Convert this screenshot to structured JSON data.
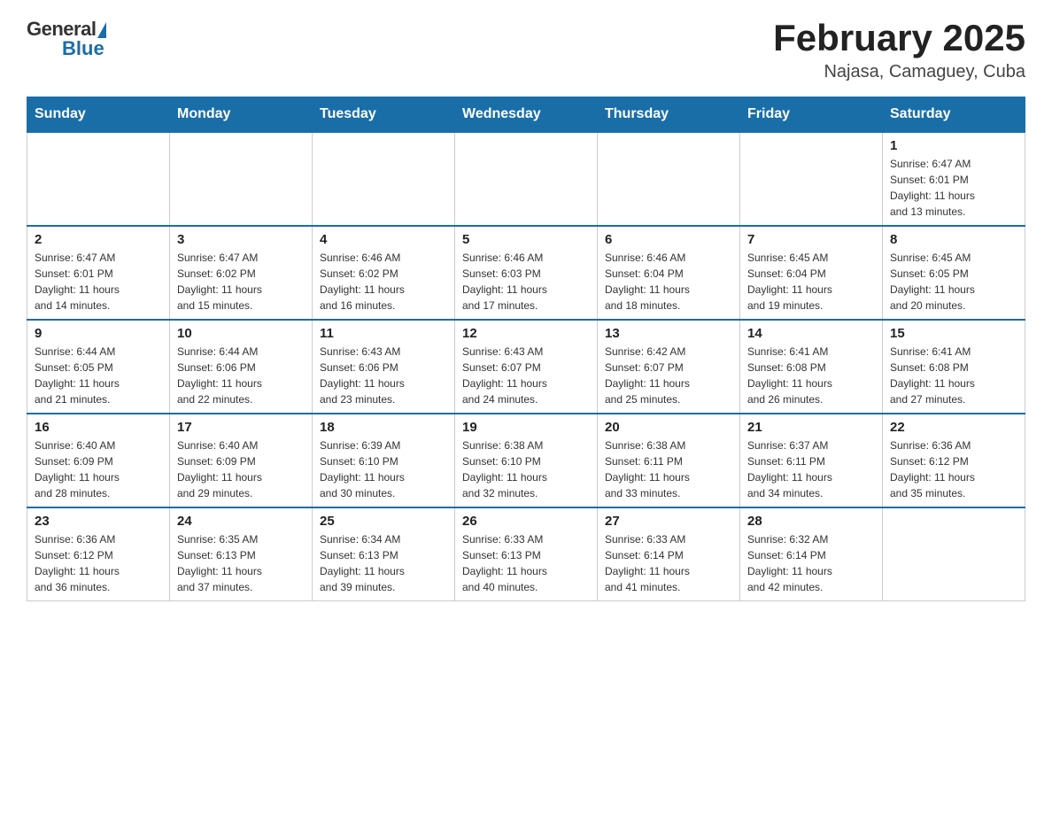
{
  "header": {
    "logo": {
      "general": "General",
      "blue": "Blue"
    },
    "title": "February 2025",
    "subtitle": "Najasa, Camaguey, Cuba"
  },
  "weekdays": [
    "Sunday",
    "Monday",
    "Tuesday",
    "Wednesday",
    "Thursday",
    "Friday",
    "Saturday"
  ],
  "weeks": [
    [
      {
        "day": "",
        "info": ""
      },
      {
        "day": "",
        "info": ""
      },
      {
        "day": "",
        "info": ""
      },
      {
        "day": "",
        "info": ""
      },
      {
        "day": "",
        "info": ""
      },
      {
        "day": "",
        "info": ""
      },
      {
        "day": "1",
        "info": "Sunrise: 6:47 AM\nSunset: 6:01 PM\nDaylight: 11 hours\nand 13 minutes."
      }
    ],
    [
      {
        "day": "2",
        "info": "Sunrise: 6:47 AM\nSunset: 6:01 PM\nDaylight: 11 hours\nand 14 minutes."
      },
      {
        "day": "3",
        "info": "Sunrise: 6:47 AM\nSunset: 6:02 PM\nDaylight: 11 hours\nand 15 minutes."
      },
      {
        "day": "4",
        "info": "Sunrise: 6:46 AM\nSunset: 6:02 PM\nDaylight: 11 hours\nand 16 minutes."
      },
      {
        "day": "5",
        "info": "Sunrise: 6:46 AM\nSunset: 6:03 PM\nDaylight: 11 hours\nand 17 minutes."
      },
      {
        "day": "6",
        "info": "Sunrise: 6:46 AM\nSunset: 6:04 PM\nDaylight: 11 hours\nand 18 minutes."
      },
      {
        "day": "7",
        "info": "Sunrise: 6:45 AM\nSunset: 6:04 PM\nDaylight: 11 hours\nand 19 minutes."
      },
      {
        "day": "8",
        "info": "Sunrise: 6:45 AM\nSunset: 6:05 PM\nDaylight: 11 hours\nand 20 minutes."
      }
    ],
    [
      {
        "day": "9",
        "info": "Sunrise: 6:44 AM\nSunset: 6:05 PM\nDaylight: 11 hours\nand 21 minutes."
      },
      {
        "day": "10",
        "info": "Sunrise: 6:44 AM\nSunset: 6:06 PM\nDaylight: 11 hours\nand 22 minutes."
      },
      {
        "day": "11",
        "info": "Sunrise: 6:43 AM\nSunset: 6:06 PM\nDaylight: 11 hours\nand 23 minutes."
      },
      {
        "day": "12",
        "info": "Sunrise: 6:43 AM\nSunset: 6:07 PM\nDaylight: 11 hours\nand 24 minutes."
      },
      {
        "day": "13",
        "info": "Sunrise: 6:42 AM\nSunset: 6:07 PM\nDaylight: 11 hours\nand 25 minutes."
      },
      {
        "day": "14",
        "info": "Sunrise: 6:41 AM\nSunset: 6:08 PM\nDaylight: 11 hours\nand 26 minutes."
      },
      {
        "day": "15",
        "info": "Sunrise: 6:41 AM\nSunset: 6:08 PM\nDaylight: 11 hours\nand 27 minutes."
      }
    ],
    [
      {
        "day": "16",
        "info": "Sunrise: 6:40 AM\nSunset: 6:09 PM\nDaylight: 11 hours\nand 28 minutes."
      },
      {
        "day": "17",
        "info": "Sunrise: 6:40 AM\nSunset: 6:09 PM\nDaylight: 11 hours\nand 29 minutes."
      },
      {
        "day": "18",
        "info": "Sunrise: 6:39 AM\nSunset: 6:10 PM\nDaylight: 11 hours\nand 30 minutes."
      },
      {
        "day": "19",
        "info": "Sunrise: 6:38 AM\nSunset: 6:10 PM\nDaylight: 11 hours\nand 32 minutes."
      },
      {
        "day": "20",
        "info": "Sunrise: 6:38 AM\nSunset: 6:11 PM\nDaylight: 11 hours\nand 33 minutes."
      },
      {
        "day": "21",
        "info": "Sunrise: 6:37 AM\nSunset: 6:11 PM\nDaylight: 11 hours\nand 34 minutes."
      },
      {
        "day": "22",
        "info": "Sunrise: 6:36 AM\nSunset: 6:12 PM\nDaylight: 11 hours\nand 35 minutes."
      }
    ],
    [
      {
        "day": "23",
        "info": "Sunrise: 6:36 AM\nSunset: 6:12 PM\nDaylight: 11 hours\nand 36 minutes."
      },
      {
        "day": "24",
        "info": "Sunrise: 6:35 AM\nSunset: 6:13 PM\nDaylight: 11 hours\nand 37 minutes."
      },
      {
        "day": "25",
        "info": "Sunrise: 6:34 AM\nSunset: 6:13 PM\nDaylight: 11 hours\nand 39 minutes."
      },
      {
        "day": "26",
        "info": "Sunrise: 6:33 AM\nSunset: 6:13 PM\nDaylight: 11 hours\nand 40 minutes."
      },
      {
        "day": "27",
        "info": "Sunrise: 6:33 AM\nSunset: 6:14 PM\nDaylight: 11 hours\nand 41 minutes."
      },
      {
        "day": "28",
        "info": "Sunrise: 6:32 AM\nSunset: 6:14 PM\nDaylight: 11 hours\nand 42 minutes."
      },
      {
        "day": "",
        "info": ""
      }
    ]
  ]
}
